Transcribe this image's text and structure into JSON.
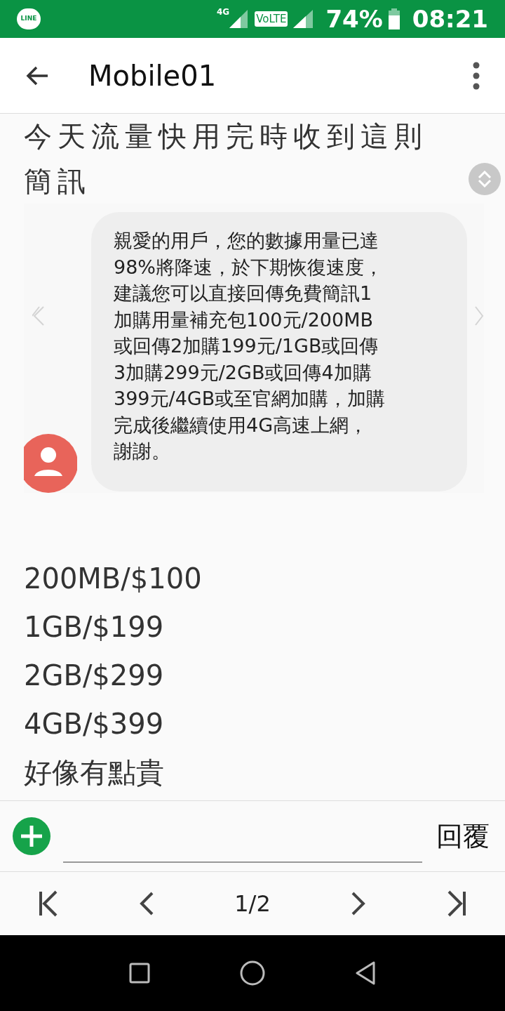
{
  "status_bar": {
    "app_logo": "LINE",
    "network": "4G",
    "volte": "VoLTE",
    "battery": "74%",
    "time": "08:21"
  },
  "app_bar": {
    "title": "Mobile01"
  },
  "post": {
    "title": "今天流量快用完時收到這則簡訊",
    "screenshot": {
      "message_lines": [
        "親愛的用戶，您的數據用量已達",
        "98%將降速，於下期恢復速度，",
        "建議您可以直接回傳免費簡訊1",
        "加購用量補充包100元/200MB",
        "或回傳2加購199元/1GB或回傳",
        "3加購299元/2GB或回傳4加購",
        "399元/4GB或至官網加購，加購",
        "完成後繼續使用4G高速上網，",
        "謝謝。"
      ]
    },
    "lines": [
      "200MB/$100",
      "1GB/$199",
      "2GB/$299",
      "4GB/$399",
      "好像有點貴"
    ]
  },
  "reply_bar": {
    "button": "回覆"
  },
  "pagination": {
    "page": "1/2"
  }
}
